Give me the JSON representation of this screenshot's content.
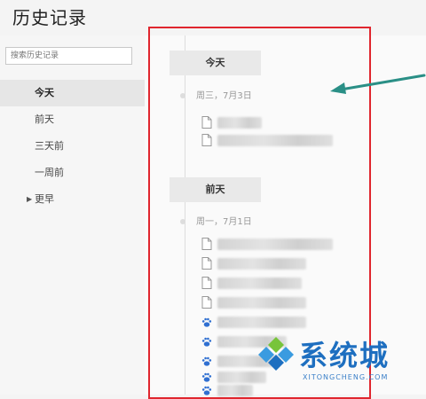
{
  "page": {
    "title": "历史记录"
  },
  "search": {
    "placeholder": "搜索历史记录"
  },
  "sidebar": {
    "items": [
      {
        "label": "今天",
        "active": true
      },
      {
        "label": "前天"
      },
      {
        "label": "三天前"
      },
      {
        "label": "一周前"
      },
      {
        "label": "更早",
        "has_caret": true
      }
    ]
  },
  "timeline": {
    "groups": [
      {
        "heading": "今天",
        "date": "周三，7月3日",
        "entry_count": 2,
        "entry_icons": [
          "page-icon",
          "page-icon"
        ]
      },
      {
        "heading": "前天",
        "date": "周一，7月1日",
        "entry_count": 9,
        "entry_icons": [
          "page-icon",
          "page-icon",
          "page-icon",
          "page-icon",
          "paw-icon",
          "paw-icon",
          "paw-icon",
          "paw-icon",
          "paw-icon"
        ]
      }
    ]
  },
  "watermark": {
    "text": "系统城",
    "domain": "XITONGCHENG.COM"
  },
  "colors": {
    "highlight_border": "#e0262e",
    "annotation_arrow": "#2a8f86",
    "watermark_blue": "#1e6fc0"
  }
}
